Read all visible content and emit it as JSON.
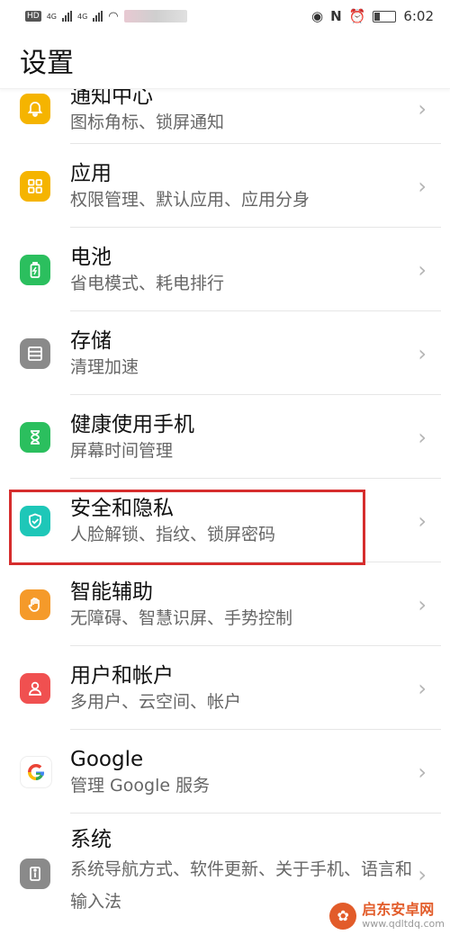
{
  "status_bar": {
    "hd": "HD",
    "net1": "4G",
    "net2": "4G",
    "time": "6:02"
  },
  "header": {
    "title": "设置"
  },
  "items": [
    {
      "title": "通知中心",
      "sub": "图标角标、锁屏通知",
      "icon": "bell-icon",
      "color": "#f5b400"
    },
    {
      "title": "应用",
      "sub": "权限管理、默认应用、应用分身",
      "icon": "grid-icon",
      "color": "#f5b400"
    },
    {
      "title": "电池",
      "sub": "省电模式、耗电排行",
      "icon": "battery-icon",
      "color": "#2bbf5e"
    },
    {
      "title": "存储",
      "sub": "清理加速",
      "icon": "storage-icon",
      "color": "#8a8a8a"
    },
    {
      "title": "健康使用手机",
      "sub": "屏幕时间管理",
      "icon": "hourglass-icon",
      "color": "#2bbf5e"
    },
    {
      "title": "安全和隐私",
      "sub": "人脸解锁、指纹、锁屏密码",
      "icon": "shield-icon",
      "color": "#1ec7b8"
    },
    {
      "title": "智能辅助",
      "sub": "无障碍、智慧识屏、手势控制",
      "icon": "hand-icon",
      "color": "#f59a2a"
    },
    {
      "title": "用户和帐户",
      "sub": "多用户、云空间、帐户",
      "icon": "user-icon",
      "color": "#f05050"
    },
    {
      "title": "Google",
      "sub": "管理 Google 服务",
      "icon": "google-icon",
      "color": "#ffffff"
    },
    {
      "title": "系统",
      "sub": "系统导航方式、软件更新、关于手机、语言和输入法",
      "icon": "info-icon",
      "color": "#8a8a8a"
    }
  ],
  "watermark": {
    "line1": "启东安卓网",
    "line2": "www.qdltdq.com"
  }
}
